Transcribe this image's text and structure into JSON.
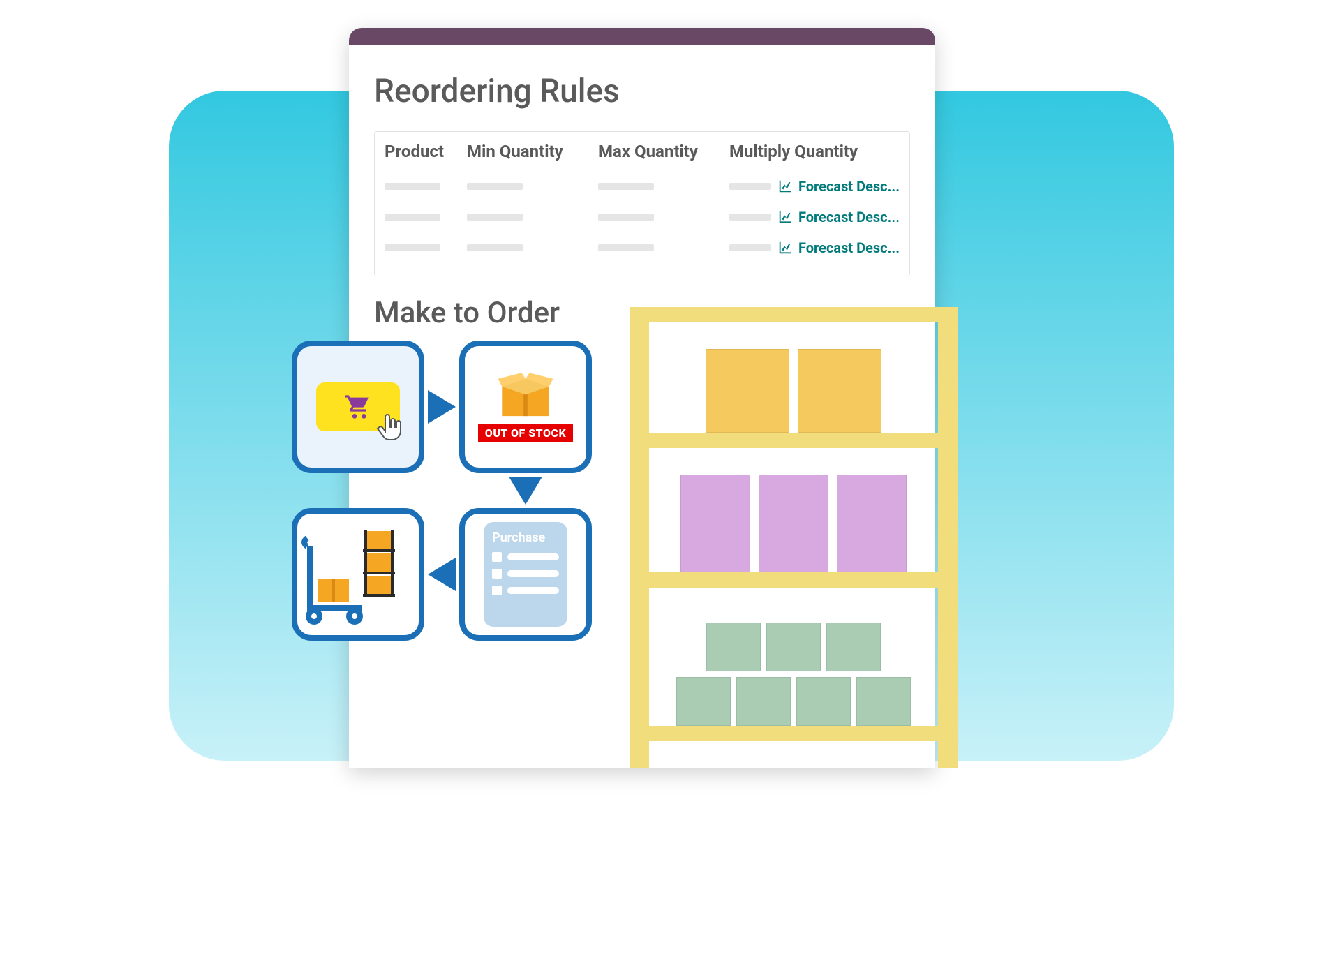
{
  "panel": {
    "title": "Reordering Rules",
    "columns": {
      "product": "Product",
      "min": "Min Quantity",
      "max": "Max Quantity",
      "multiply": "Multiply Quantity"
    },
    "forecast_label": "Forecast Desc..."
  },
  "section2_title": "Make to Order",
  "flow": {
    "out_of_stock_label": "OUT OF STOCK",
    "purchase_label": "Purchase"
  },
  "colors": {
    "titlebar": "#684865",
    "accent_blue": "#1b6fb6",
    "link_teal": "#007a7a",
    "yellow_btn": "#ffe21f",
    "oos_red": "#e60000"
  }
}
